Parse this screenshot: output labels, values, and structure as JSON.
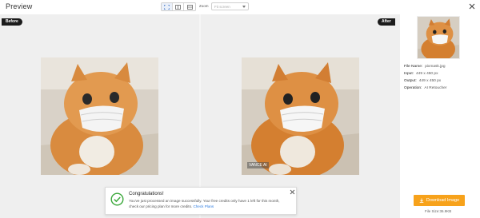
{
  "header": {
    "title": "Preview",
    "zoom_label": "Zoom",
    "zoom_select_value": "Fit screen"
  },
  "view_modes": [
    "split-view-icon",
    "side-by-side-icon",
    "stacked-view-icon"
  ],
  "panels": {
    "before_label": "Before",
    "after_label": "After",
    "watermark": "VANCE AI"
  },
  "file_info": {
    "name_label": "File Name:",
    "name_value": "pixmask.jpg",
    "input_label": "Input:",
    "input_value": "449 x 450 px",
    "output_label": "Output:",
    "output_value": "449 x 450 px",
    "operation_label": "Operation:",
    "operation_value": "AI Retoucher"
  },
  "download": {
    "button_label": "Download Image",
    "file_size": "File Size:36.9KB"
  },
  "toast": {
    "title": "Congratulations!",
    "body": "You've just processed an image successfully. Your free credits only have 1 left for this month, check our pricing plan for more credits.",
    "link": "Check Plans"
  },
  "colors": {
    "accent": "#f7a21b",
    "success": "#3aa83a",
    "link": "#2f7de1",
    "badge": "#1b1b1b"
  }
}
